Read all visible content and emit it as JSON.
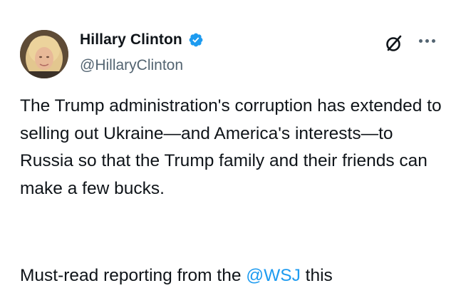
{
  "author": {
    "display_name": "Hillary Clinton",
    "handle": "@HillaryClinton",
    "verified": true
  },
  "tweet": {
    "paragraph_1": "The Trump administration's corruption has extended to selling out Ukraine—and America's interests—to Russia so that the Trump family and their friends can make a few bucks.",
    "paragraph_2_prefix": "Must-read reporting from the ",
    "paragraph_2_mention": "@WSJ",
    "paragraph_2_suffix": " this"
  },
  "icons": {
    "verified": "verified-badge-icon",
    "grok": "grok-icon",
    "more": "more-options-icon"
  },
  "colors": {
    "text": "#0f1419",
    "secondary": "#536471",
    "accent": "#1d9bf0"
  }
}
